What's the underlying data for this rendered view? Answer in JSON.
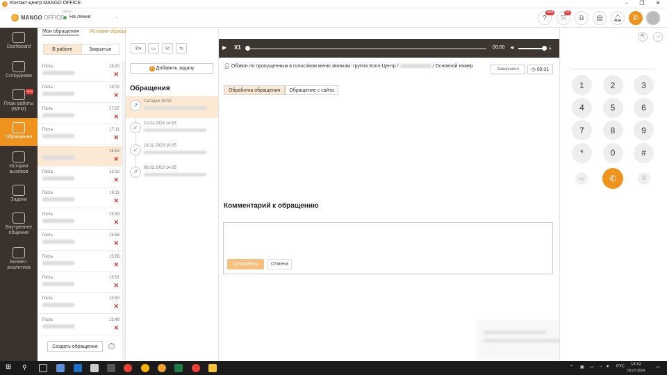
{
  "window": {
    "title": "Контакт-центр MANGO OFFICE",
    "controls": [
      "–",
      "❐",
      "✕"
    ]
  },
  "header": {
    "brand": "MANGO",
    "brand_suffix": "OFFICE",
    "status_label": "статус",
    "status_value": "На линии",
    "badge_new": "new",
    "badge_count": "62"
  },
  "leftnav": [
    {
      "label": "Dashboard",
      "icon": "dashboard-icon"
    },
    {
      "label": "Сотрудники",
      "icon": "employees-icon"
    },
    {
      "label": "План работы (WFM)",
      "icon": "wfm-icon",
      "badge": "NEW"
    },
    {
      "label": "Обращения",
      "icon": "requests-icon",
      "active": true
    },
    {
      "label": "История вызовов",
      "icon": "call-history-icon"
    },
    {
      "label": "Задачи",
      "icon": "tasks-icon"
    },
    {
      "label": "Внутреннее общение",
      "icon": "chat-icon"
    },
    {
      "label": "Бизнес-аналитика",
      "icon": "analytics-icon"
    }
  ],
  "col1": {
    "tabs": [
      "Мои обращения",
      "История обращений"
    ],
    "segment": [
      "В работе",
      "Закрытые"
    ],
    "items": [
      {
        "name": "Гость",
        "time": "18:20"
      },
      {
        "name": "Гость",
        "time": "18:02"
      },
      {
        "name": "Гость",
        "time": "17:57"
      },
      {
        "name": "Гость",
        "time": "17:11"
      },
      {
        "name": "",
        "time": "16:53",
        "selected": true
      },
      {
        "name": "Гость",
        "time": "16:12"
      },
      {
        "name": "Гость",
        "time": "16:11"
      },
      {
        "name": "Гость",
        "time": "15:59"
      },
      {
        "name": "Гость",
        "time": "15:58"
      },
      {
        "name": "Гость",
        "time": "15:56"
      },
      {
        "name": "Гость",
        "time": "15:51"
      },
      {
        "name": "Гость",
        "time": "15:50"
      },
      {
        "name": "Гость",
        "time": "15:48"
      }
    ],
    "create_button": "Создать обращение",
    "help": "?"
  },
  "col2": {
    "add_task": "Добавить задачу",
    "section_title": "Обращения",
    "timeline": [
      {
        "date": "Сегодня 16:53",
        "dir": "↗",
        "color": "#3a7bd5",
        "selected": true
      },
      {
        "date": "10.01.2024 14:53",
        "dir": "↙",
        "color": "#4caf50"
      },
      {
        "date": "18.12.2023 10:05",
        "dir": "↙",
        "color": "#4caf50"
      },
      {
        "date": "06.02.2023 14:05",
        "dir": "↗",
        "color": "#4caf50"
      }
    ]
  },
  "player": {
    "play": "▶",
    "speed": "X1",
    "time": "00:00"
  },
  "call": {
    "text_prefix": "Обзвон по пропущенным в голосовом меню звонкам: группа Колл-Центр /",
    "text_suffix": "/ Основной номер",
    "status": "Завершено",
    "duration": "00:31"
  },
  "form_tabs": [
    "Обработка обращения",
    "Обращение с сайта"
  ],
  "comment": {
    "title": "Комментарий к обращению",
    "save": "Сохранить",
    "cancel": "Отмена"
  },
  "dialpad": {
    "keys": [
      "1",
      "2",
      "3",
      "4",
      "5",
      "6",
      "7",
      "8",
      "9",
      "*",
      "0",
      "#"
    ]
  },
  "taskbar": {
    "lang": "РУС",
    "time": "18:42",
    "date": "09.07.2024"
  }
}
